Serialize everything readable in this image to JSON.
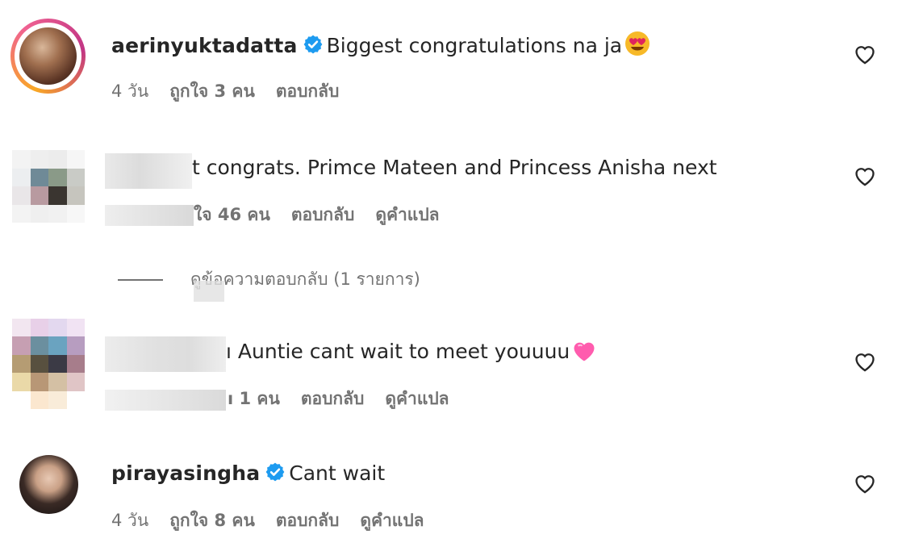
{
  "colors": {
    "text": "#262626",
    "secondary": "#737373",
    "verified": "#1d9bf0"
  },
  "comments": [
    {
      "username": "aerinyuktadatta",
      "verified": true,
      "text": "Biggest congratulations na ja",
      "emoji": "heart-eyes-emoji",
      "time": "4 วัน",
      "likes": "ถูกใจ 3 คน",
      "reply": "ตอบกลับ"
    },
    {
      "username": "",
      "text": "t congrats. Primce Mateen and Princess Anisha next",
      "likes": "ใจ 46 คน",
      "reply": "ตอบกลับ",
      "translate": "ดูคำแปล",
      "view_replies": "ดูข้อความตอบกลับ (1 รายการ)"
    },
    {
      "username": "",
      "text": "ı Auntie cant wait to meet youuuu",
      "emoji": "pink-heart-emoji",
      "likes": "ı 1 คน",
      "reply": "ตอบกลับ",
      "translate": "ดูคำแปล"
    },
    {
      "username": "pirayasingha",
      "verified": true,
      "text": "Cant wait",
      "time": "4 วัน",
      "likes": "ถูกใจ 8 คน",
      "reply": "ตอบกลับ",
      "translate": "ดูคำแปล"
    }
  ]
}
